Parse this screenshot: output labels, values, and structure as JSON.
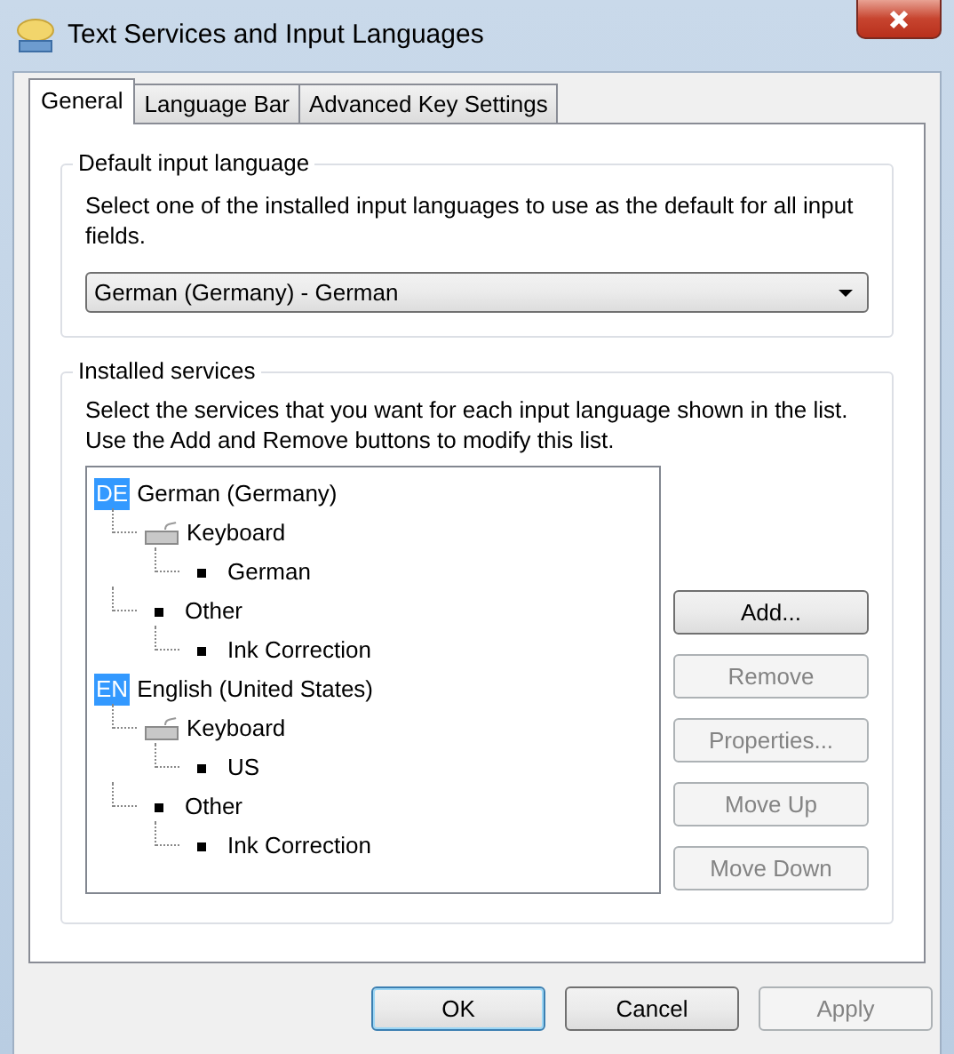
{
  "window": {
    "title": "Text Services and Input Languages"
  },
  "tabs": [
    {
      "label": "General",
      "selected": true
    },
    {
      "label": "Language Bar",
      "selected": false
    },
    {
      "label": "Advanced Key Settings",
      "selected": false
    }
  ],
  "default_language": {
    "heading": "Default input language",
    "description": "Select one of the installed input languages to use as the default for all input fields.",
    "value": "German (Germany) - German"
  },
  "installed_services": {
    "heading": "Installed services",
    "description": "Select the services that you want for each input language shown in the list. Use the Add and Remove buttons to modify this list.",
    "tree": [
      {
        "code": "DE",
        "label": "German (Germany)",
        "children": [
          {
            "kind": "keyboard",
            "label": "Keyboard",
            "children": [
              {
                "kind": "item",
                "label": "German"
              }
            ]
          },
          {
            "kind": "other",
            "label": "Other",
            "children": [
              {
                "kind": "item",
                "label": "Ink Correction"
              }
            ]
          }
        ]
      },
      {
        "code": "EN",
        "label": "English (United States)",
        "children": [
          {
            "kind": "keyboard",
            "label": "Keyboard",
            "children": [
              {
                "kind": "item",
                "label": "US"
              }
            ]
          },
          {
            "kind": "other",
            "label": "Other",
            "children": [
              {
                "kind": "item",
                "label": "Ink Correction"
              }
            ]
          }
        ]
      }
    ],
    "buttons": [
      {
        "label": "Add...",
        "disabled": false
      },
      {
        "label": "Remove",
        "disabled": true
      },
      {
        "label": "Properties...",
        "disabled": true
      },
      {
        "label": "Move Up",
        "disabled": true
      },
      {
        "label": "Move Down",
        "disabled": true
      }
    ]
  },
  "footer_buttons": [
    {
      "label": "OK",
      "default": true,
      "disabled": false
    },
    {
      "label": "Cancel",
      "default": false,
      "disabled": false
    },
    {
      "label": "Apply",
      "default": false,
      "disabled": true
    }
  ]
}
